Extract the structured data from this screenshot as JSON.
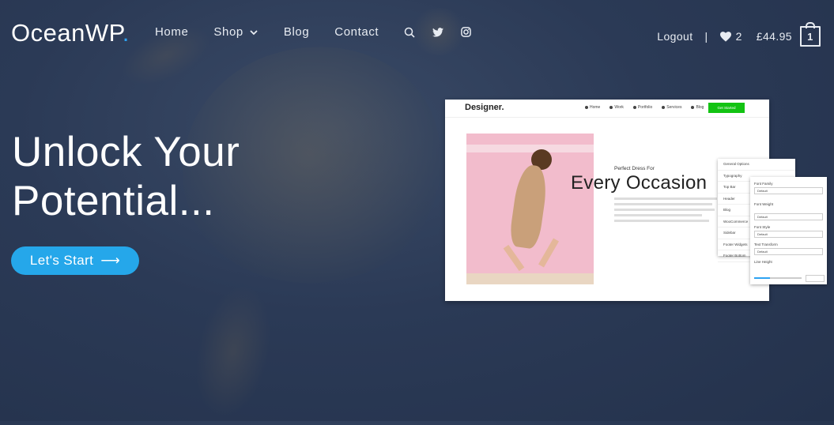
{
  "header": {
    "logo_text": "OceanWP",
    "logo_dot": ".",
    "nav": {
      "home": "Home",
      "shop": "Shop",
      "blog": "Blog",
      "contact": "Contact"
    },
    "logout": "Logout",
    "separator": "|",
    "wishlist_count": "2",
    "cart_total": "£44.95",
    "cart_count": "1"
  },
  "hero": {
    "title_line1": "Unlock Your",
    "title_line2": "Potential...",
    "cta_label": "Let's Start",
    "cta_arrow": "⟶"
  },
  "preview": {
    "logo": "Designer.",
    "nav": [
      "Home",
      "Work",
      "Portfolio",
      "Services",
      "Blog"
    ],
    "button": "Get Started",
    "subtitle": "Perfect Dress For",
    "headline": "Every Occasion",
    "panel_menu": [
      "General Options",
      "Typography",
      "Top Bar",
      "Header",
      "Blog",
      "WooCommerce",
      "Sidebar",
      "Footer Widgets",
      "Footer Bottom"
    ],
    "panel_fields": [
      {
        "label": "Font Family",
        "value": "Default"
      },
      {
        "label": "Font Weight",
        "value": "Default"
      },
      {
        "label": "Font Style",
        "value": "Default"
      },
      {
        "label": "Text Transform",
        "value": "Default"
      }
    ],
    "panel_line_height": "Line Height"
  },
  "colors": {
    "accent": "#2ea3f2",
    "cta": "#25a7ea",
    "background": "#2b3a56",
    "preview_button": "#13c313"
  }
}
